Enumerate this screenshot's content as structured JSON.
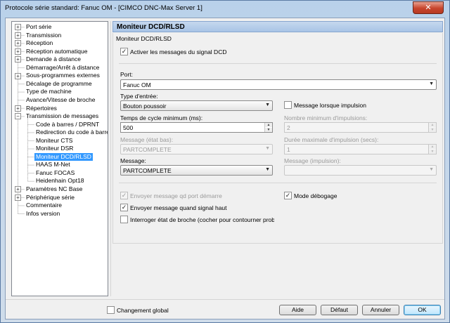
{
  "window": {
    "title": "Protocole série standard: Fanuc OM - [CIMCO DNC-Max Server 1]",
    "close_glyph": "✕"
  },
  "tree": {
    "items": [
      {
        "label": "Port série",
        "expander": "+"
      },
      {
        "label": "Transmission",
        "expander": "+"
      },
      {
        "label": "Réception",
        "expander": "+"
      },
      {
        "label": "Réception automatique",
        "expander": "+"
      },
      {
        "label": "Demande à distance",
        "expander": "+"
      },
      {
        "label": "Démarrage/Arrêt à distance",
        "expander": ""
      },
      {
        "label": "Sous-programmes externes",
        "expander": "+"
      },
      {
        "label": "Décalage de programme",
        "expander": ""
      },
      {
        "label": "Type de machine",
        "expander": ""
      },
      {
        "label": "Avance/Vitesse de broche",
        "expander": ""
      },
      {
        "label": "Répertoires",
        "expander": "+"
      },
      {
        "label": "Transmission de messages",
        "expander": "−"
      },
      {
        "label": "Code à barres / DPRNT",
        "expander": ""
      },
      {
        "label": "Redirection du code à barres",
        "expander": ""
      },
      {
        "label": "Moniteur CTS",
        "expander": ""
      },
      {
        "label": "Moniteur DSR",
        "expander": ""
      },
      {
        "label": "Moniteur DCD/RLSD",
        "expander": "",
        "selected": true
      },
      {
        "label": "HAAS M-Net",
        "expander": ""
      },
      {
        "label": "Fanuc FOCAS",
        "expander": ""
      },
      {
        "label": "Heidenhain Opt18",
        "expander": ""
      },
      {
        "label": "Paramètres NC Base",
        "expander": "+"
      },
      {
        "label": "Périphérique série",
        "expander": "+"
      },
      {
        "label": "Commentaire",
        "expander": ""
      },
      {
        "label": "Infos version",
        "expander": ""
      }
    ]
  },
  "panel": {
    "header": "Moniteur DCD/RLSD",
    "group_label": "Moniteur DCD/RLSD",
    "enable_label": "Activer les messages du signal DCD",
    "enable_checked": true,
    "port_label": "Port:",
    "port_value": "Fanuc OM",
    "input_type_label": "Type d'entrée:",
    "input_type_value": "Bouton poussoir",
    "msg_on_pulse_label": "Message lorsque impulsion",
    "msg_on_pulse_checked": false,
    "min_cycle_label": "Temps de cycle minimum (ms):",
    "min_cycle_value": "500",
    "min_pulses_label": "Nombre minimum d'impulsions:",
    "min_pulses_value": "2",
    "msg_low_label": "Message (état bas):",
    "msg_low_value": "PARTCOMPLETE",
    "max_pulse_label": "Durée maximale d'impulsion (secs):",
    "max_pulse_value": "1",
    "message_label": "Message:",
    "message_value": "PARTCOMPLETE",
    "msg_pulse_label": "Message (impulsion):",
    "msg_pulse_value": "",
    "send_on_start_label": "Envoyer message qd port démarre",
    "send_on_start_checked": true,
    "debug_label": "Mode débogage",
    "debug_checked": true,
    "send_high_label": "Envoyer message quand signal haut",
    "send_high_checked": true,
    "query_spindle_label": "Interroger état de broche (cocher pour contourner prob. de p",
    "query_spindle_checked": false
  },
  "footer": {
    "global_change_label": "Changement global",
    "global_change_checked": false,
    "help_label": "Aide",
    "default_label": "Défaut",
    "cancel_label": "Annuler",
    "ok_label": "OK"
  },
  "glyphs": {
    "check": "✓",
    "down": "▼",
    "up": "▲"
  }
}
